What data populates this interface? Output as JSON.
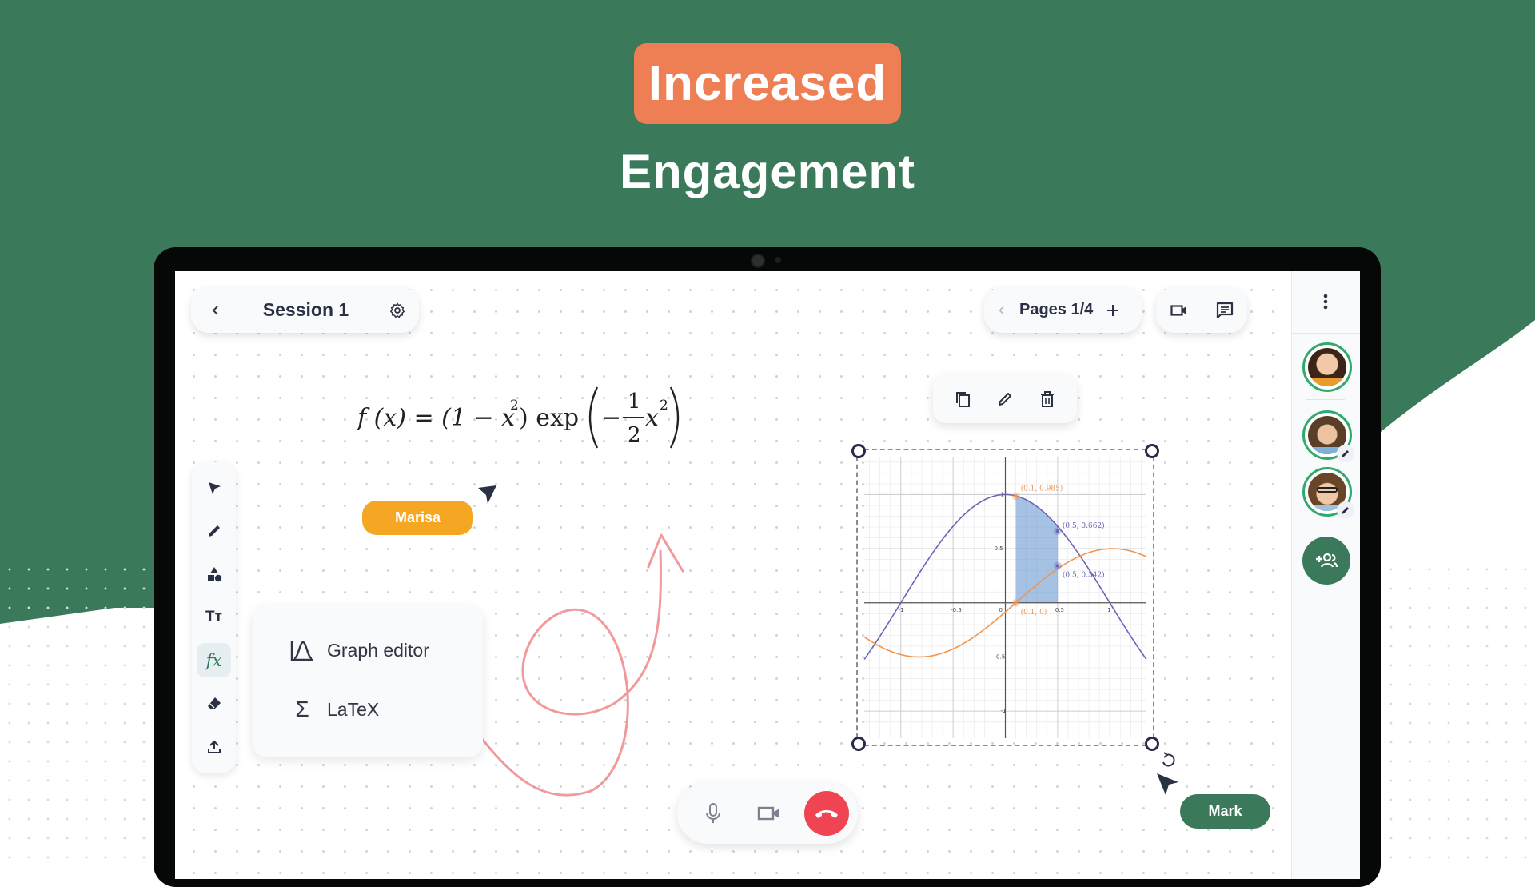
{
  "hero": {
    "badge_text": "Increased",
    "subtitle": "Engagement",
    "colors": {
      "green": "#3a7a5b",
      "badge": "#ee7f55"
    }
  },
  "topbar": {
    "back_icon": "chevron-left-icon",
    "session_title": "Session 1",
    "settings_icon": "gear-icon",
    "pages_prev_icon": "chevron-left-icon",
    "pages_label": "Pages 1/4",
    "add_page_icon": "plus-icon",
    "video_icon": "video-camera-icon",
    "chat_icon": "chat-icon"
  },
  "sidebar": {
    "more_icon": "more-vertical-icon",
    "participants": [
      {
        "name": "participant-1",
        "editing": false
      },
      {
        "name": "participant-2",
        "editing": true
      },
      {
        "name": "participant-3",
        "editing": true
      }
    ],
    "add_participant_icon": "add-person-icon"
  },
  "toolbar": {
    "tools": [
      {
        "name": "select",
        "icon": "pointer-icon",
        "active": false
      },
      {
        "name": "pen",
        "icon": "pencil-icon",
        "active": false
      },
      {
        "name": "shapes",
        "icon": "shapes-icon",
        "active": false
      },
      {
        "name": "text",
        "icon": "text-icon",
        "active": false
      },
      {
        "name": "formula",
        "icon": "function-icon",
        "active": true
      },
      {
        "name": "eraser",
        "icon": "eraser-icon",
        "active": false
      },
      {
        "name": "upload",
        "icon": "upload-icon",
        "active": false
      }
    ],
    "text_glyph": "Tт",
    "formula_glyph": "fx"
  },
  "formula_menu": {
    "items": [
      {
        "label": "Graph editor",
        "icon": "graph-icon"
      },
      {
        "label": "LaTeX",
        "icon": "sigma-icon",
        "glyph": "Σ"
      }
    ]
  },
  "canvas": {
    "formula": {
      "lhs": "f (x) = (1 − x",
      "sup1": "2",
      "mid": ") exp",
      "minus": "−",
      "num": "1",
      "den": "2",
      "x": "x",
      "sup2": "2"
    },
    "cursors": [
      {
        "user": "Marisa",
        "color": "#f5a623"
      },
      {
        "user": "Mark",
        "color": "#3a7a5b"
      }
    ],
    "scribble_color": "#f19a9c"
  },
  "graph_toolbar": {
    "copy_icon": "copy-icon",
    "edit_icon": "pencil-icon",
    "delete_icon": "trash-icon"
  },
  "call_bar": {
    "mic_icon": "microphone-icon",
    "video_icon": "video-camera-icon",
    "hangup_icon": "phone-hangup-icon",
    "hangup_color": "#f04452"
  },
  "chart_data": {
    "type": "line",
    "title": "",
    "xlabel": "",
    "ylabel": "",
    "xlim": [
      -1.35,
      1.35
    ],
    "ylim": [
      -1.25,
      1.35
    ],
    "grid": true,
    "x_ticks": [
      "-1",
      "-0.5",
      "0",
      "0.5",
      "1"
    ],
    "x_tick_values": [
      -1,
      -0.5,
      0,
      0.5,
      1
    ],
    "y_ticks": [
      "1",
      "0.5",
      "-0.5",
      "-1"
    ],
    "y_tick_values": [
      1,
      0.5,
      -0.5,
      -1
    ],
    "series": [
      {
        "name": "f(x) = (1 - x^2) exp(-x^2/2) style curve",
        "color": "#6b63b5",
        "function": "cos_bell"
      },
      {
        "name": "orange curve",
        "color": "#f0954e",
        "function": "sine_shifted"
      }
    ],
    "shaded_region": {
      "x_from": 0.1,
      "x_to": 0.5,
      "color": "#5b8fcf"
    },
    "annotations": [
      {
        "x": 0.1,
        "y": 0.985,
        "label": "(0.1, 0.985)",
        "color": "#f0954e"
      },
      {
        "x": 0.5,
        "y": 0.662,
        "label": "(0.5, 0.662)",
        "color": "#6b63b5"
      },
      {
        "x": 0.5,
        "y": 0.342,
        "label": "(0.5, 0.342)",
        "color": "#6b63b5"
      },
      {
        "x": 0.1,
        "y": 0,
        "label": "(0.1, 0)",
        "color": "#f0954e"
      }
    ]
  }
}
